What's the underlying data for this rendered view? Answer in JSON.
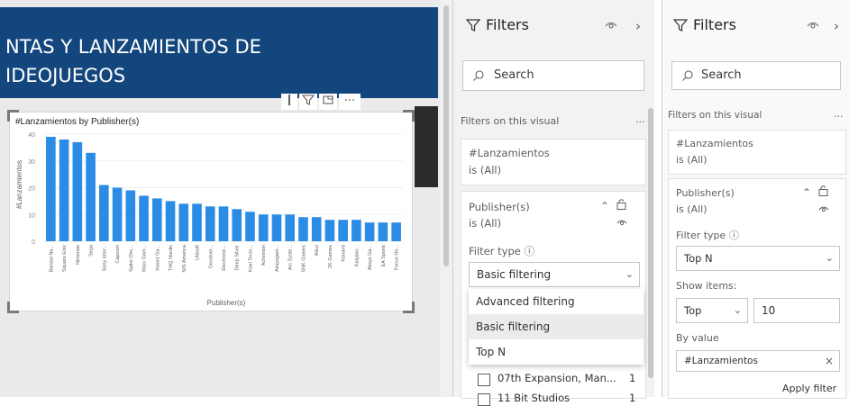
{
  "report": {
    "title_line1": "NTAS Y LANZAMIENTOS DE",
    "title_line2": "IDEOJUEGOS",
    "visual_header": {
      "more": "···"
    }
  },
  "chart_data": {
    "type": "bar",
    "title": "#Lanzamientos by Publisher(s)",
    "xlabel": "Publisher(s)",
    "ylabel": "#Lanzamientos",
    "ylim": [
      0,
      40
    ],
    "yticks": [
      0,
      10,
      20,
      30,
      40
    ],
    "grid": true,
    "color": "#2b8ce6",
    "categories": [
      "Bandai Na...",
      "Square Enix",
      "Nintendo",
      "Sega",
      "Sony Inter...",
      "Capcom",
      "Spike Chu...",
      "Xbox Gam...",
      "Xseed Ga...",
      "THQ Nordic",
      "NIS America",
      "Ubisoft",
      "Devolver...",
      "Electronic...",
      "Deep Silver",
      "Koei Tecm...",
      "Activision",
      "Aksysgam...",
      "Arc Syste...",
      "SNK Games",
      "Atlus",
      "2K Games",
      "Konami",
      "Kalypso...",
      "Aksys Ga...",
      "EA Sports",
      "Focus Ho..."
    ],
    "values": [
      39,
      38,
      37,
      33,
      21,
      20,
      19,
      17,
      16,
      15,
      14,
      14,
      13,
      13,
      12,
      11,
      10,
      10,
      10,
      9,
      9,
      8,
      8,
      8,
      7,
      7,
      7
    ]
  },
  "filters1": {
    "title": "Filters",
    "search_placeholder": "Search",
    "section": "Filters on this visual",
    "more": "...",
    "card1": {
      "field": "#Lanzamientos",
      "state": "is (All)"
    },
    "card2": {
      "field": "Publisher(s)",
      "state": "is (All)",
      "filter_type_label": "Filter type",
      "info": "ⓘ",
      "selected": "Basic filtering",
      "options": [
        "Advanced filtering",
        "Basic filtering",
        "Top N"
      ]
    },
    "list_items": [
      {
        "label": "07th Expansion, Man...",
        "count": "1"
      },
      {
        "label": "11 Bit Studios",
        "count": "1"
      }
    ]
  },
  "filters2": {
    "title": "Filters",
    "search_placeholder": "Search",
    "section": "Filters on this visual",
    "more": "...",
    "card1": {
      "field": "#Lanzamientos",
      "state": "is (All)"
    },
    "card2": {
      "field": "Publisher(s)",
      "state": "is (All)",
      "filter_type_label": "Filter type",
      "info": "ⓘ",
      "selected": "Top N",
      "show_items_label": "Show items:",
      "show_dir": "Top",
      "show_count": "10",
      "by_value_label": "By value",
      "by_value_field": "#Lanzamientos",
      "clear": "×",
      "apply": "Apply filter"
    }
  }
}
